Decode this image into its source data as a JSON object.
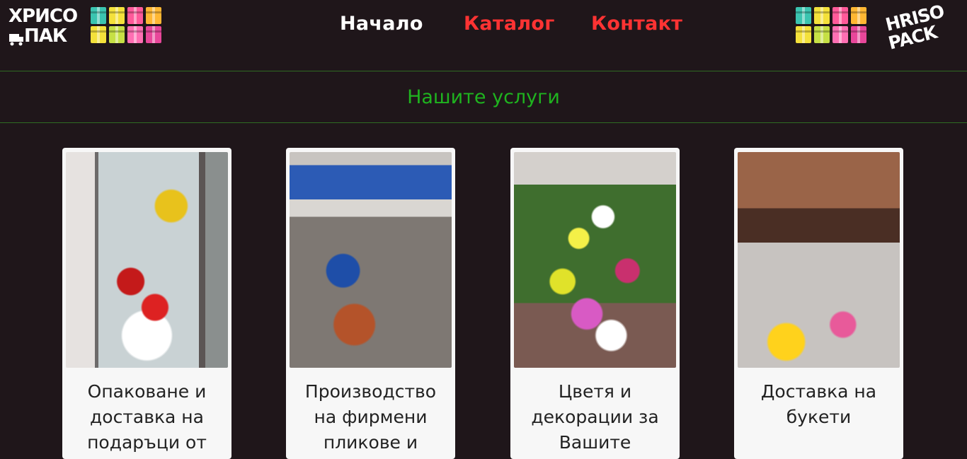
{
  "header": {
    "logo_left": {
      "line1": "ХРИСО",
      "line2": "ПАК"
    },
    "logo_right": {
      "line1": "HRISO",
      "line2": "PACK"
    },
    "gift_colors": [
      "#3bc4b0",
      "#f4e13b",
      "#ff5a9a",
      "#ffb733",
      "#f4e13b",
      "#c6e045",
      "#ff6fb3",
      "#e8479a"
    ]
  },
  "nav": {
    "items": [
      {
        "label": "Начало",
        "color": "#ffffff"
      },
      {
        "label": "Каталог",
        "color": "#ff3333"
      },
      {
        "label": "Контакт",
        "color": "#ff3333"
      }
    ]
  },
  "section": {
    "title": "Нашите услуги"
  },
  "cards": [
    {
      "title": "Опаковане и доставка на подаръци от"
    },
    {
      "title": "Производство на фирмени пликове и"
    },
    {
      "title": "Цветя и декорации за Вашите"
    },
    {
      "title": "Доставка на букети"
    }
  ],
  "colors": {
    "background": "#1f161a",
    "divider": "#2f6b23",
    "section_title": "#1fb31f",
    "card": "#f7f7f7"
  }
}
